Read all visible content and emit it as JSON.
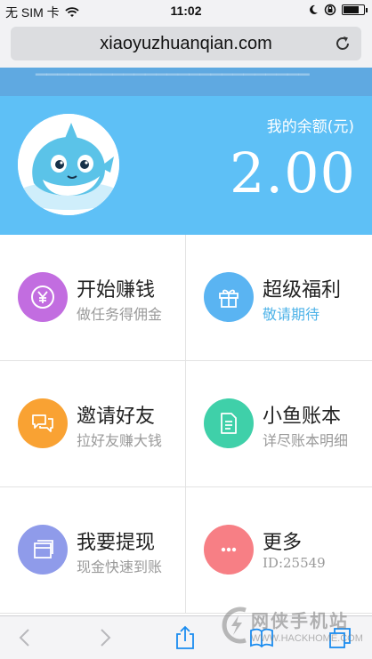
{
  "status_bar": {
    "carrier": "无 SIM 卡",
    "time": "11:02",
    "battery_level": 0.85
  },
  "browser": {
    "url": "xiaoyuzhuanqian.com"
  },
  "page": {
    "balance_label": "我的余额(元)",
    "balance_value": "2.00",
    "colors": {
      "hero_background": "#5ec0f6",
      "top_strip": "#5fa9e1"
    },
    "menu": [
      {
        "title": "开始赚钱",
        "subtitle": "做任务得佣金",
        "icon": "yen-icon",
        "color": "#c26de0"
      },
      {
        "title": "超级福利",
        "subtitle": "敬请期待",
        "icon": "gift-icon",
        "color": "#5ab4f2"
      },
      {
        "title": "邀请好友",
        "subtitle": "拉好友赚大钱",
        "icon": "chat-bubbles-icon",
        "color": "#f9a233"
      },
      {
        "title": "小鱼账本",
        "subtitle": "详尽账本明细",
        "icon": "document-icon",
        "color": "#3fd0a9"
      },
      {
        "title": "我要提现",
        "subtitle": "现金快速到账",
        "icon": "card-icon",
        "color": "#8f9bea"
      },
      {
        "title": "更多",
        "subtitle": "ID:25549",
        "icon": "more-dots-icon",
        "color": "#f77f85"
      }
    ]
  },
  "watermark": {
    "text": "网侠手机站",
    "url": "WWW.HACKHOME.COM"
  }
}
